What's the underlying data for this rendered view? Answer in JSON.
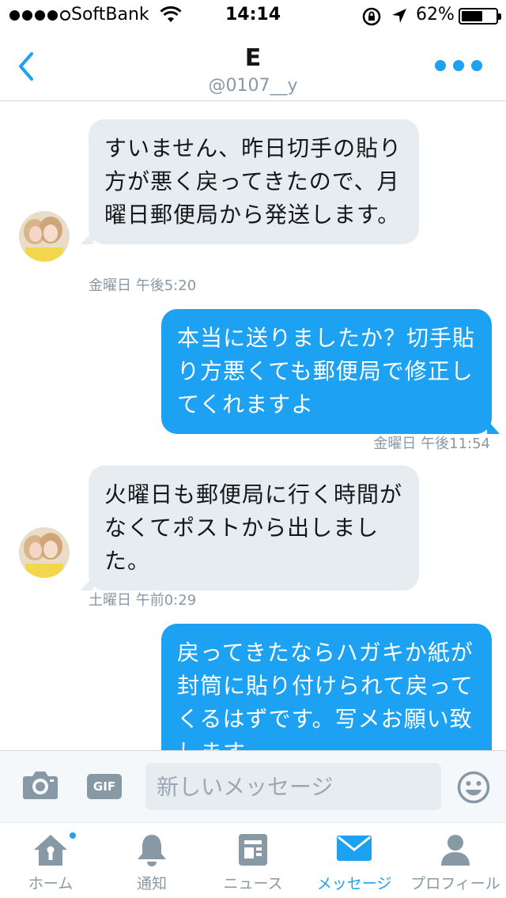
{
  "status_bar": {
    "carrier": "SoftBank",
    "time": "14:14",
    "battery_percent_text": "62%",
    "battery_level": 0.62,
    "signal_bars": 4
  },
  "header": {
    "back_icon": "chevron-left-icon",
    "title": "E",
    "handle": "@0107__y",
    "more_icon": "more-dots-icon"
  },
  "messages": [
    {
      "direction": "received",
      "text": "すいません、昨日切手の貼り方が悪く戻ってきたので、月曜日郵便局から発送します。",
      "timestamp": "金曜日 午後5:20"
    },
    {
      "direction": "sent",
      "text": "本当に送りましたか？切手貼り方悪くても郵便局で修正してくれますよ",
      "timestamp": "金曜日 午後11:54"
    },
    {
      "direction": "received",
      "text": "火曜日も郵便局に行く時間がなくてポストから出しました。",
      "timestamp": "土曜日 午前0:29"
    },
    {
      "direction": "sent",
      "text": "戻ってきたならハガキか紙が封筒に貼り付けられて戻ってくるはずです。写メお願い致します",
      "timestamp": ""
    }
  ],
  "compose": {
    "camera_icon": "camera-icon",
    "gif_label": "GIF",
    "placeholder": "新しいメッセージ",
    "emoji_icon": "smiley-icon"
  },
  "tabs": [
    {
      "label": "ホーム",
      "icon": "home-icon",
      "active": false,
      "has_badge": true
    },
    {
      "label": "通知",
      "icon": "bell-icon",
      "active": false,
      "has_badge": false
    },
    {
      "label": "ニュース",
      "icon": "news-icon",
      "active": false,
      "has_badge": false
    },
    {
      "label": "メッセージ",
      "icon": "envelope-icon",
      "active": true,
      "has_badge": false
    },
    {
      "label": "プロフィール",
      "icon": "person-icon",
      "active": false,
      "has_badge": false
    }
  ],
  "colors": {
    "accent": "#1da1f2",
    "received_bubble": "#e6ecf0",
    "muted_text": "#8899a6"
  }
}
